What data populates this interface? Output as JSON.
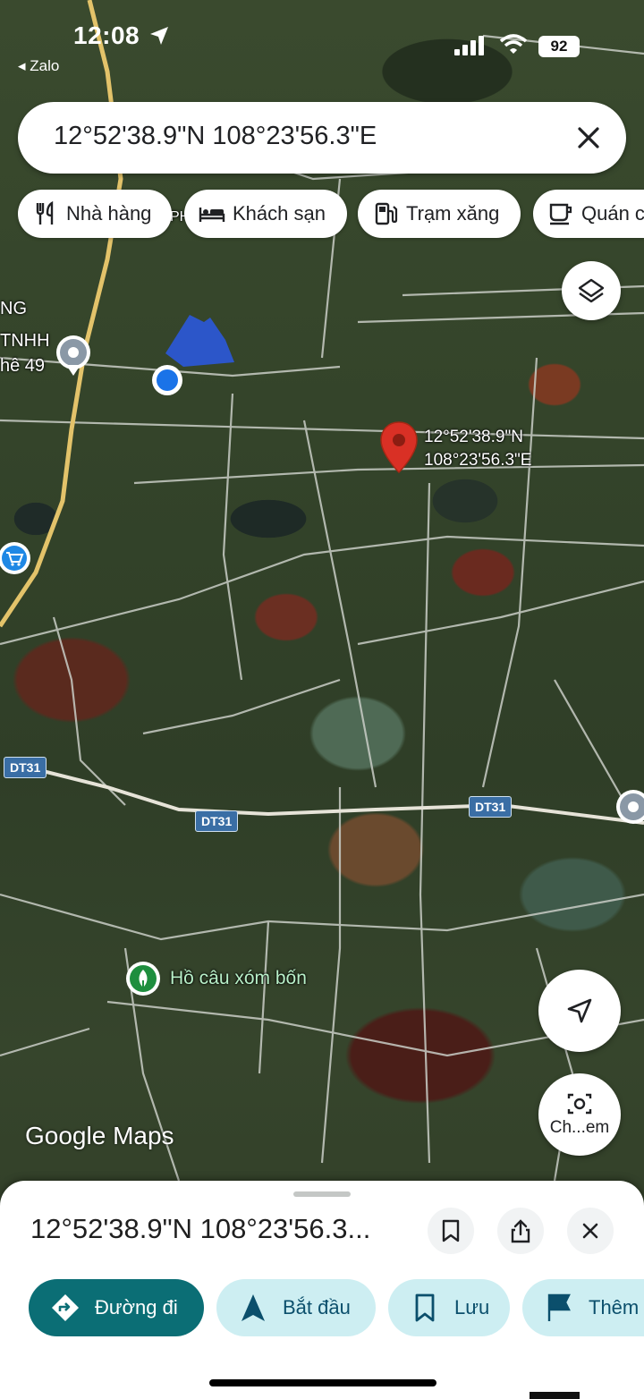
{
  "status_bar": {
    "time": "12:08",
    "back_app": "◂ Zalo",
    "battery": "92"
  },
  "search": {
    "query": "12°52'38.9\"N 108°23'56.3\"E"
  },
  "chips": [
    {
      "label": "Nhà hàng",
      "icon": "fork-knife-icon"
    },
    {
      "label": "Khách sạn",
      "icon": "bed-icon"
    },
    {
      "label": "Trạm xăng",
      "icon": "gas-pump-icon"
    },
    {
      "label": "Quán c",
      "icon": "coffee-cup-icon"
    }
  ],
  "map": {
    "pin_lat": "12°52'38.9\"N",
    "pin_lng": "108°23'56.3\"E",
    "left_labels": [
      "NG",
      "TNHH",
      "hê 49"
    ],
    "road_badges": [
      "DT31",
      "DT31",
      "DT31"
    ],
    "poi_name": "Hồ câu xóm bốn",
    "watermark": "Google Maps",
    "camera_button_label": "Ch...em",
    "partial_label": "PH"
  },
  "sheet": {
    "title": "12°52'38.9\"N 108°23'56.3...",
    "actions": [
      {
        "label": "Đường đi",
        "icon": "directions-icon"
      },
      {
        "label": "Bắt đầu",
        "icon": "navigation-arrow-icon"
      },
      {
        "label": "Lưu",
        "icon": "bookmark-icon"
      },
      {
        "label": "Thêm",
        "icon": "flag-icon"
      }
    ]
  },
  "colors": {
    "primary_action": "#0b6e75",
    "secondary_action": "#cdeef2",
    "pin_red": "#d93025",
    "location_blue": "#1a73e8"
  }
}
